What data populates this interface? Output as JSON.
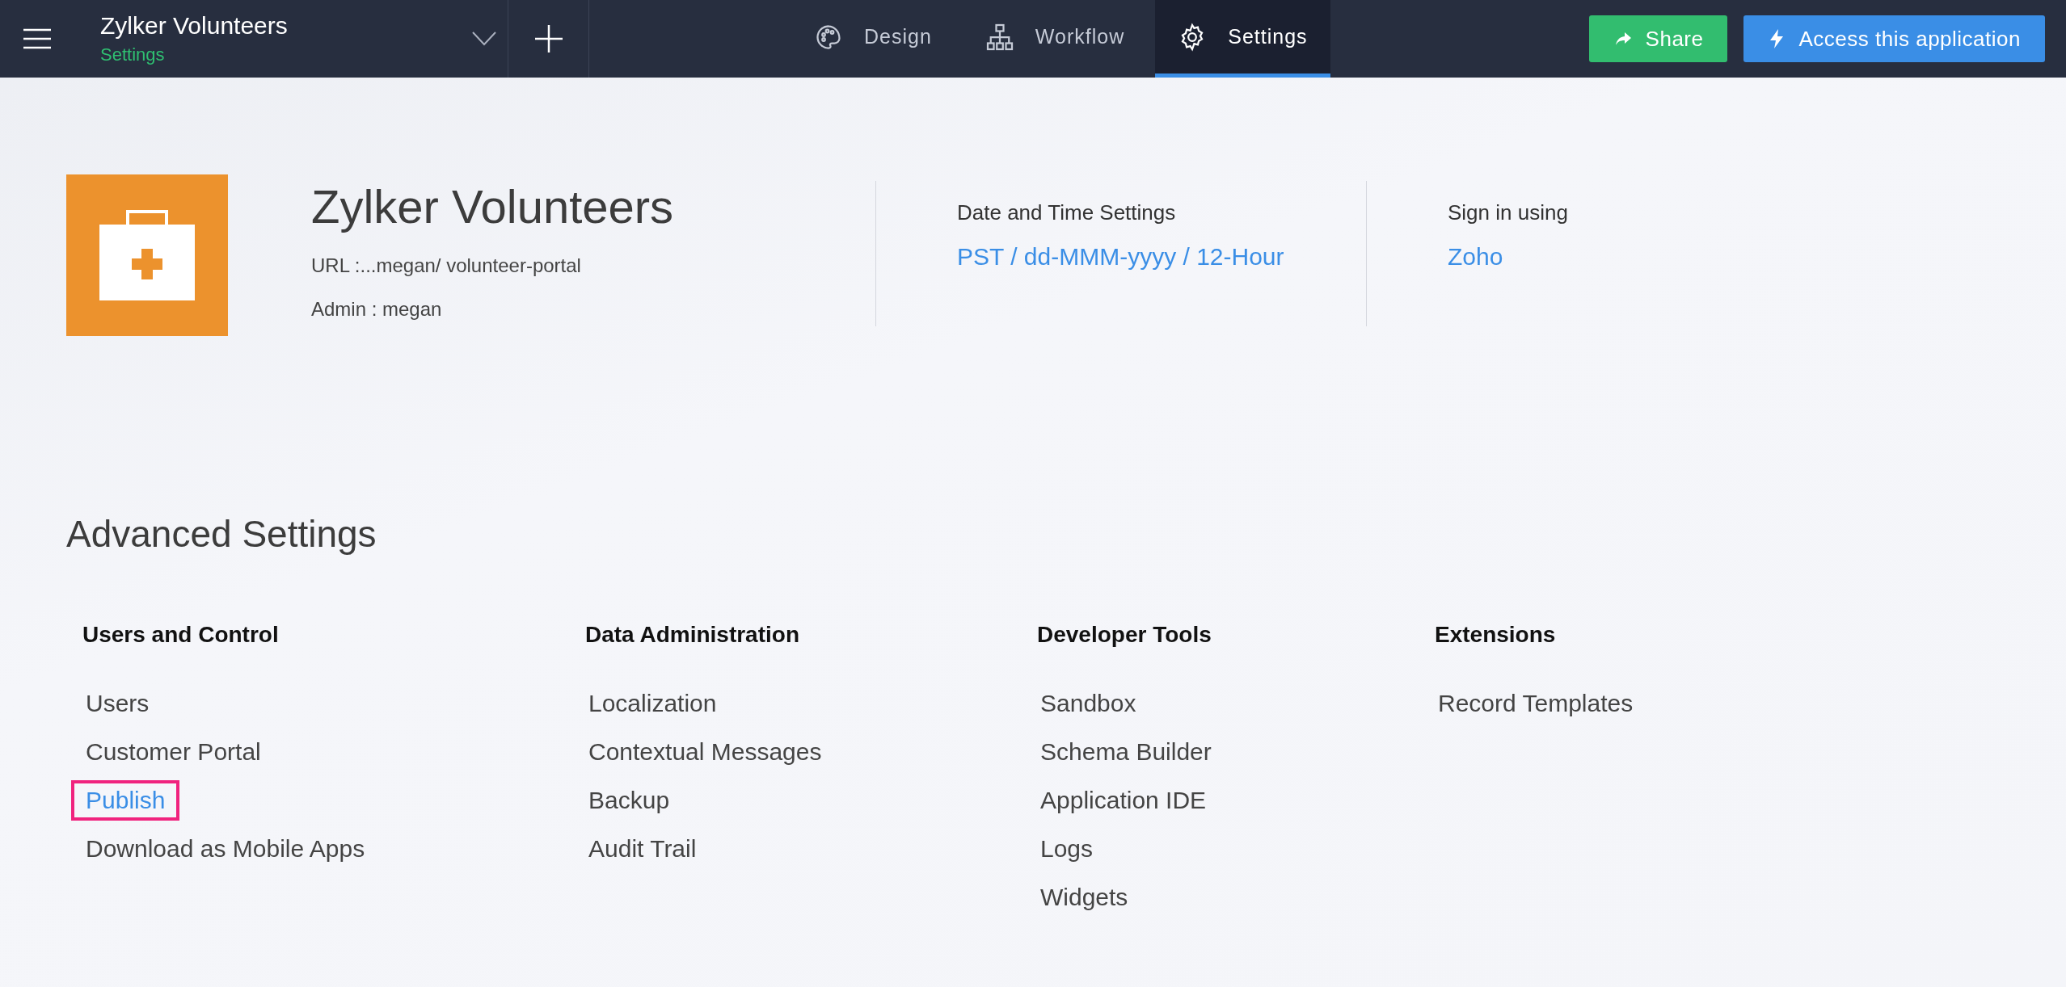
{
  "topbar": {
    "app_name": "Zylker Volunteers",
    "section": "Settings",
    "tabs": [
      {
        "label": "Design",
        "kind": "palette",
        "selected": false
      },
      {
        "label": "Workflow",
        "kind": "flow",
        "selected": false
      },
      {
        "label": "Settings",
        "kind": "gear",
        "selected": true
      }
    ],
    "buttons": [
      {
        "label": "Share",
        "kind": "share"
      },
      {
        "label": "Access this application",
        "kind": "access"
      }
    ]
  },
  "app": {
    "title": "Zylker Volunteers",
    "url_label": "URL :",
    "url": "...megan/ volunteer-portal",
    "admin_label": "Admin :",
    "admin": "megan"
  },
  "info": [
    {
      "label": "Date and Time Settings",
      "value": "PST / dd-MMM-yyyy / 12-Hour"
    },
    {
      "label": "Sign in using",
      "value": "Zoho"
    }
  ],
  "advanced": {
    "title": "Advanced Settings",
    "columns": [
      {
        "heading": "Users and Control",
        "items": [
          {
            "label": "Users",
            "highlighted": false
          },
          {
            "label": "Customer Portal",
            "highlighted": false
          },
          {
            "label": "Publish",
            "highlighted": true
          },
          {
            "label": "Download as Mobile Apps",
            "highlighted": false
          }
        ]
      },
      {
        "heading": "Data Administration",
        "items": [
          {
            "label": "Localization",
            "highlighted": false
          },
          {
            "label": "Contextual Messages",
            "highlighted": false
          },
          {
            "label": "Backup",
            "highlighted": false
          },
          {
            "label": "Audit Trail",
            "highlighted": false
          }
        ]
      },
      {
        "heading": "Developer Tools",
        "items": [
          {
            "label": "Sandbox",
            "highlighted": false
          },
          {
            "label": "Schema Builder",
            "highlighted": false
          },
          {
            "label": "Application IDE",
            "highlighted": false
          },
          {
            "label": "Logs",
            "highlighted": false
          },
          {
            "label": "Widgets",
            "highlighted": false
          }
        ]
      },
      {
        "heading": "Extensions",
        "items": [
          {
            "label": "Record Templates",
            "highlighted": false
          }
        ]
      }
    ]
  }
}
